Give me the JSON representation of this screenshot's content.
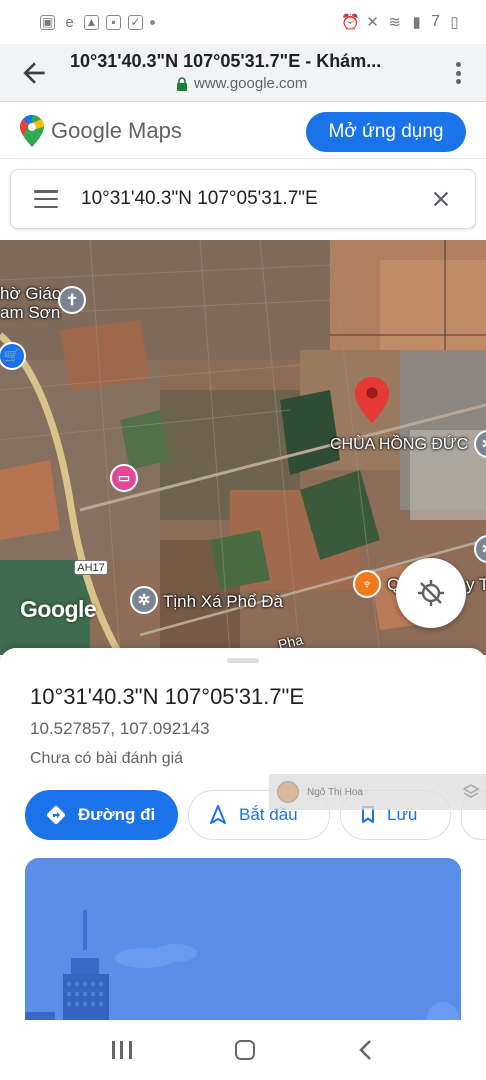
{
  "status_bar": {
    "battery_text": "7",
    "colors": {
      "icon": "#7a7a7a"
    }
  },
  "browser": {
    "page_title": "10°31'40.3\"N 107°05'31.7\"E - Khám...",
    "url": "www.google.com",
    "lock_color": "#188038"
  },
  "maps_header": {
    "logo_text": "Google Maps",
    "open_app_label": "Mở ứng dụng",
    "accent": "#1a73e8"
  },
  "search": {
    "query": "10°31'40.3\"N 107°05'31.7\"E"
  },
  "map": {
    "labels": {
      "church_line1": "hờ Giáo",
      "church_line2": "am Sơn",
      "pagoda": "CHÙA HỒNG ĐỨC",
      "temple": "Tịnh Xá Phổ Đà",
      "restaurant_partial": "Q",
      "road": "Pha",
      "road_shield": "AH17",
      "partial_right": "y T"
    },
    "wordmark": "Google"
  },
  "place": {
    "title": "10°31'40.3\"N 107°05'31.7\"E",
    "coords": "10.527857, 107.092143",
    "reviews": "Chưa có bài đánh giá",
    "actions": [
      {
        "label": "Đường đi",
        "icon": "directions-icon"
      },
      {
        "label": "Bắt đầu",
        "icon": "navigation-icon"
      },
      {
        "label": "Lưu",
        "icon": "bookmark-icon"
      }
    ]
  },
  "watermark": {
    "name": "Ngô Thị Hoa"
  }
}
